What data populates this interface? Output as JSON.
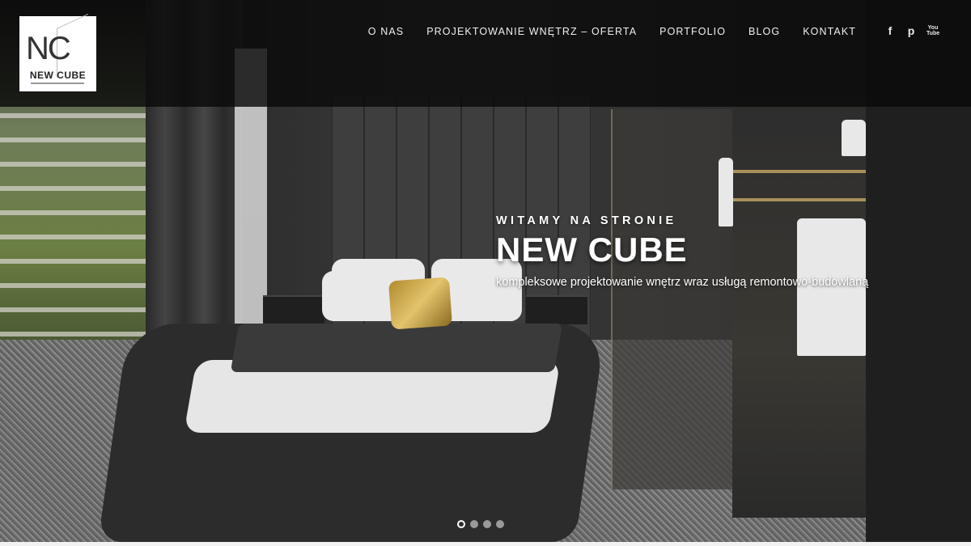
{
  "logo": {
    "mark": "NC",
    "name": "NEW CUBE"
  },
  "nav": {
    "items": [
      {
        "label": "O NAS"
      },
      {
        "label": "PROJEKTOWANIE WNĘTRZ – OFERTA"
      },
      {
        "label": "PORTFOLIO"
      },
      {
        "label": "BLOG"
      },
      {
        "label": "KONTAKT"
      }
    ]
  },
  "social": {
    "facebook": "f",
    "pinterest": "p",
    "youtube": "You Tube"
  },
  "icons": [
    "facebook-icon",
    "pinterest-icon",
    "youtube-icon"
  ],
  "hero": {
    "kicker": "WITAMY NA STRONIE",
    "title": "NEW CUBE",
    "subtitle": "kompleksowe projektowanie wnętrz wraz usługą remontowo-budowlaną"
  },
  "slider": {
    "total": 4,
    "active": 1
  },
  "colors": {
    "header_bg": "#0a0a0a",
    "text": "#ffffff",
    "accent_gold": "#c9a84a"
  }
}
